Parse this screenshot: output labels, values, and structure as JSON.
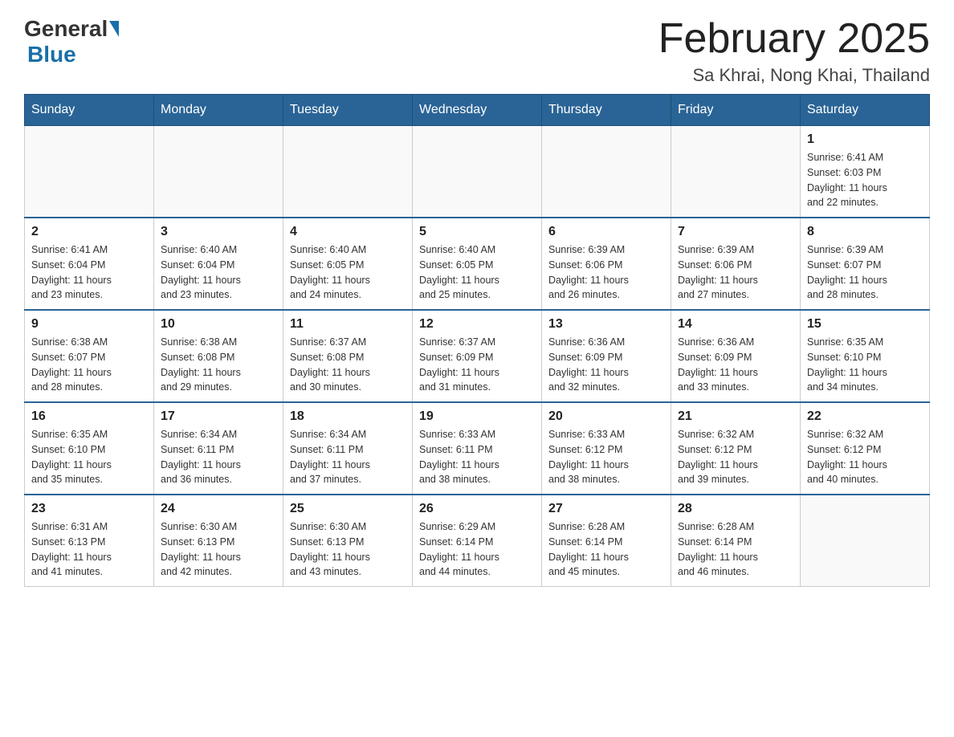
{
  "header": {
    "logo_general": "General",
    "logo_blue": "Blue",
    "title": "February 2025",
    "subtitle": "Sa Khrai, Nong Khai, Thailand"
  },
  "weekdays": [
    "Sunday",
    "Monday",
    "Tuesday",
    "Wednesday",
    "Thursday",
    "Friday",
    "Saturday"
  ],
  "weeks": [
    [
      {
        "day": "",
        "info": ""
      },
      {
        "day": "",
        "info": ""
      },
      {
        "day": "",
        "info": ""
      },
      {
        "day": "",
        "info": ""
      },
      {
        "day": "",
        "info": ""
      },
      {
        "day": "",
        "info": ""
      },
      {
        "day": "1",
        "info": "Sunrise: 6:41 AM\nSunset: 6:03 PM\nDaylight: 11 hours\nand 22 minutes."
      }
    ],
    [
      {
        "day": "2",
        "info": "Sunrise: 6:41 AM\nSunset: 6:04 PM\nDaylight: 11 hours\nand 23 minutes."
      },
      {
        "day": "3",
        "info": "Sunrise: 6:40 AM\nSunset: 6:04 PM\nDaylight: 11 hours\nand 23 minutes."
      },
      {
        "day": "4",
        "info": "Sunrise: 6:40 AM\nSunset: 6:05 PM\nDaylight: 11 hours\nand 24 minutes."
      },
      {
        "day": "5",
        "info": "Sunrise: 6:40 AM\nSunset: 6:05 PM\nDaylight: 11 hours\nand 25 minutes."
      },
      {
        "day": "6",
        "info": "Sunrise: 6:39 AM\nSunset: 6:06 PM\nDaylight: 11 hours\nand 26 minutes."
      },
      {
        "day": "7",
        "info": "Sunrise: 6:39 AM\nSunset: 6:06 PM\nDaylight: 11 hours\nand 27 minutes."
      },
      {
        "day": "8",
        "info": "Sunrise: 6:39 AM\nSunset: 6:07 PM\nDaylight: 11 hours\nand 28 minutes."
      }
    ],
    [
      {
        "day": "9",
        "info": "Sunrise: 6:38 AM\nSunset: 6:07 PM\nDaylight: 11 hours\nand 28 minutes."
      },
      {
        "day": "10",
        "info": "Sunrise: 6:38 AM\nSunset: 6:08 PM\nDaylight: 11 hours\nand 29 minutes."
      },
      {
        "day": "11",
        "info": "Sunrise: 6:37 AM\nSunset: 6:08 PM\nDaylight: 11 hours\nand 30 minutes."
      },
      {
        "day": "12",
        "info": "Sunrise: 6:37 AM\nSunset: 6:09 PM\nDaylight: 11 hours\nand 31 minutes."
      },
      {
        "day": "13",
        "info": "Sunrise: 6:36 AM\nSunset: 6:09 PM\nDaylight: 11 hours\nand 32 minutes."
      },
      {
        "day": "14",
        "info": "Sunrise: 6:36 AM\nSunset: 6:09 PM\nDaylight: 11 hours\nand 33 minutes."
      },
      {
        "day": "15",
        "info": "Sunrise: 6:35 AM\nSunset: 6:10 PM\nDaylight: 11 hours\nand 34 minutes."
      }
    ],
    [
      {
        "day": "16",
        "info": "Sunrise: 6:35 AM\nSunset: 6:10 PM\nDaylight: 11 hours\nand 35 minutes."
      },
      {
        "day": "17",
        "info": "Sunrise: 6:34 AM\nSunset: 6:11 PM\nDaylight: 11 hours\nand 36 minutes."
      },
      {
        "day": "18",
        "info": "Sunrise: 6:34 AM\nSunset: 6:11 PM\nDaylight: 11 hours\nand 37 minutes."
      },
      {
        "day": "19",
        "info": "Sunrise: 6:33 AM\nSunset: 6:11 PM\nDaylight: 11 hours\nand 38 minutes."
      },
      {
        "day": "20",
        "info": "Sunrise: 6:33 AM\nSunset: 6:12 PM\nDaylight: 11 hours\nand 38 minutes."
      },
      {
        "day": "21",
        "info": "Sunrise: 6:32 AM\nSunset: 6:12 PM\nDaylight: 11 hours\nand 39 minutes."
      },
      {
        "day": "22",
        "info": "Sunrise: 6:32 AM\nSunset: 6:12 PM\nDaylight: 11 hours\nand 40 minutes."
      }
    ],
    [
      {
        "day": "23",
        "info": "Sunrise: 6:31 AM\nSunset: 6:13 PM\nDaylight: 11 hours\nand 41 minutes."
      },
      {
        "day": "24",
        "info": "Sunrise: 6:30 AM\nSunset: 6:13 PM\nDaylight: 11 hours\nand 42 minutes."
      },
      {
        "day": "25",
        "info": "Sunrise: 6:30 AM\nSunset: 6:13 PM\nDaylight: 11 hours\nand 43 minutes."
      },
      {
        "day": "26",
        "info": "Sunrise: 6:29 AM\nSunset: 6:14 PM\nDaylight: 11 hours\nand 44 minutes."
      },
      {
        "day": "27",
        "info": "Sunrise: 6:28 AM\nSunset: 6:14 PM\nDaylight: 11 hours\nand 45 minutes."
      },
      {
        "day": "28",
        "info": "Sunrise: 6:28 AM\nSunset: 6:14 PM\nDaylight: 11 hours\nand 46 minutes."
      },
      {
        "day": "",
        "info": ""
      }
    ]
  ]
}
